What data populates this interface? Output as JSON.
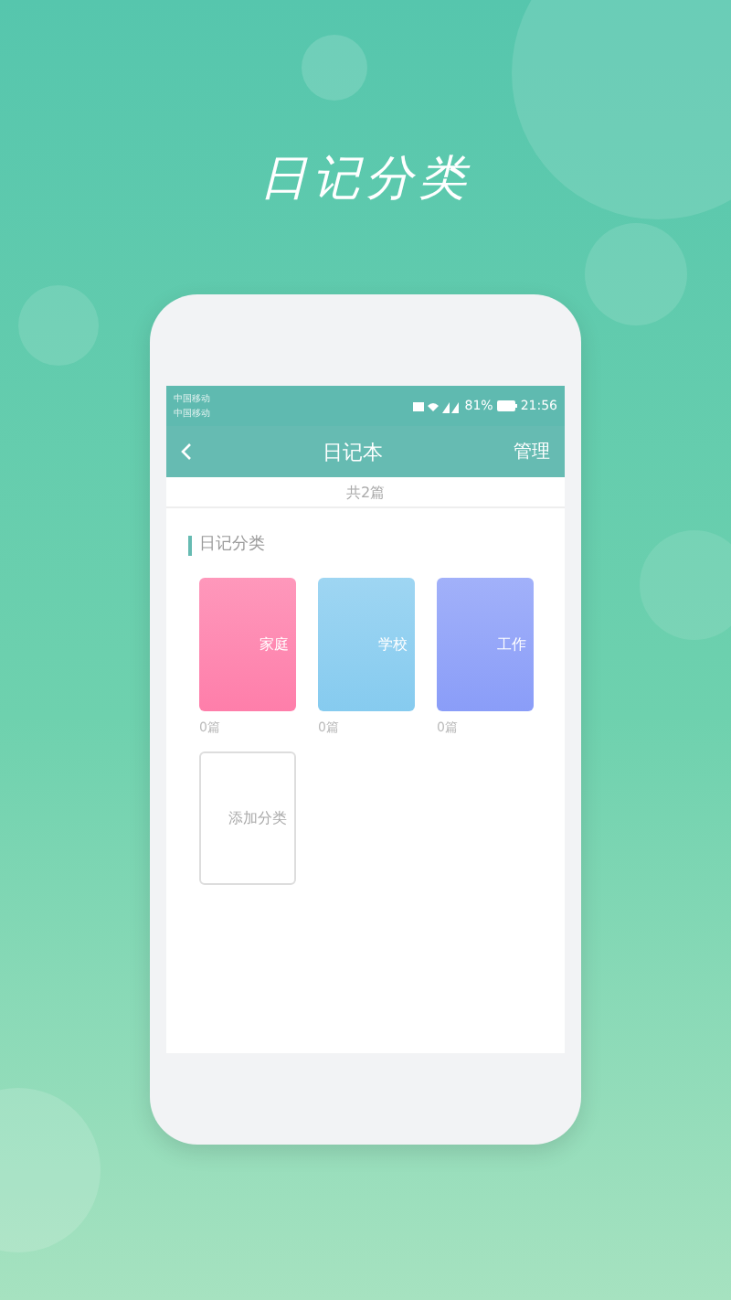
{
  "headline": "日记分类",
  "status_bar": {
    "carriers": [
      "中国移动",
      "中国移动"
    ],
    "battery": "81%",
    "time": "21:56"
  },
  "nav": {
    "title": "日记本",
    "action": "管理"
  },
  "count": "共2篇",
  "section_title": "日记分类",
  "categories": [
    {
      "name": "家庭",
      "count": "0篇",
      "color": "#fe7eaa"
    },
    {
      "name": "学校",
      "count": "0篇",
      "color": "#86cbef"
    },
    {
      "name": "工作",
      "count": "0篇",
      "color": "#8a9df8"
    }
  ],
  "add_button": "添加分类"
}
